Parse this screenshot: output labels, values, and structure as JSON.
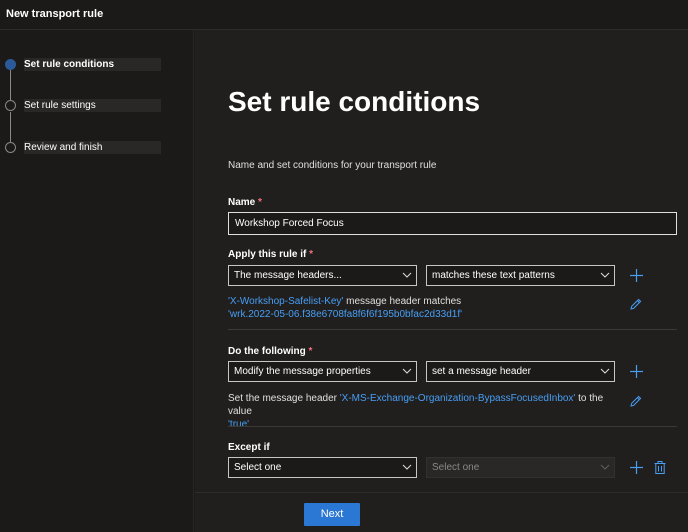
{
  "window": {
    "title": "New transport rule"
  },
  "steps": [
    {
      "label": "Set rule conditions",
      "active": true
    },
    {
      "label": "Set rule settings",
      "active": false
    },
    {
      "label": "Review and finish",
      "active": false
    }
  ],
  "page": {
    "heading": "Set rule conditions",
    "subtitle": "Name and set conditions for your transport rule"
  },
  "name_field": {
    "label": "Name",
    "required": "*",
    "value": "Workshop Forced Focus"
  },
  "apply_rule": {
    "label": "Apply this rule if",
    "required": "*",
    "condition": "The message headers...",
    "operator": "matches these text patterns",
    "desc_link1": "'X-Workshop-Safelist-Key'",
    "desc_middle": " message header matches",
    "desc_link2": "'wrk.2022-05-06.f38e6708fa8f6f6f195b0bfac2d33d1f'"
  },
  "do_following": {
    "label": "Do the following",
    "required": "*",
    "action": "Modify the message properties",
    "property": "set a message header",
    "desc_prefix": "Set the message header ",
    "desc_link1": "'X-MS-Exchange-Organization-BypassFocusedInbox'",
    "desc_middle": " to the value",
    "desc_link2": "'true'"
  },
  "except_if": {
    "label": "Except if",
    "select1": "Select one",
    "select2": "Select one"
  },
  "footer": {
    "next_label": "Next"
  },
  "colors": {
    "accent": "#2b78d4",
    "link": "#479ef5",
    "required": "#f1707b"
  }
}
